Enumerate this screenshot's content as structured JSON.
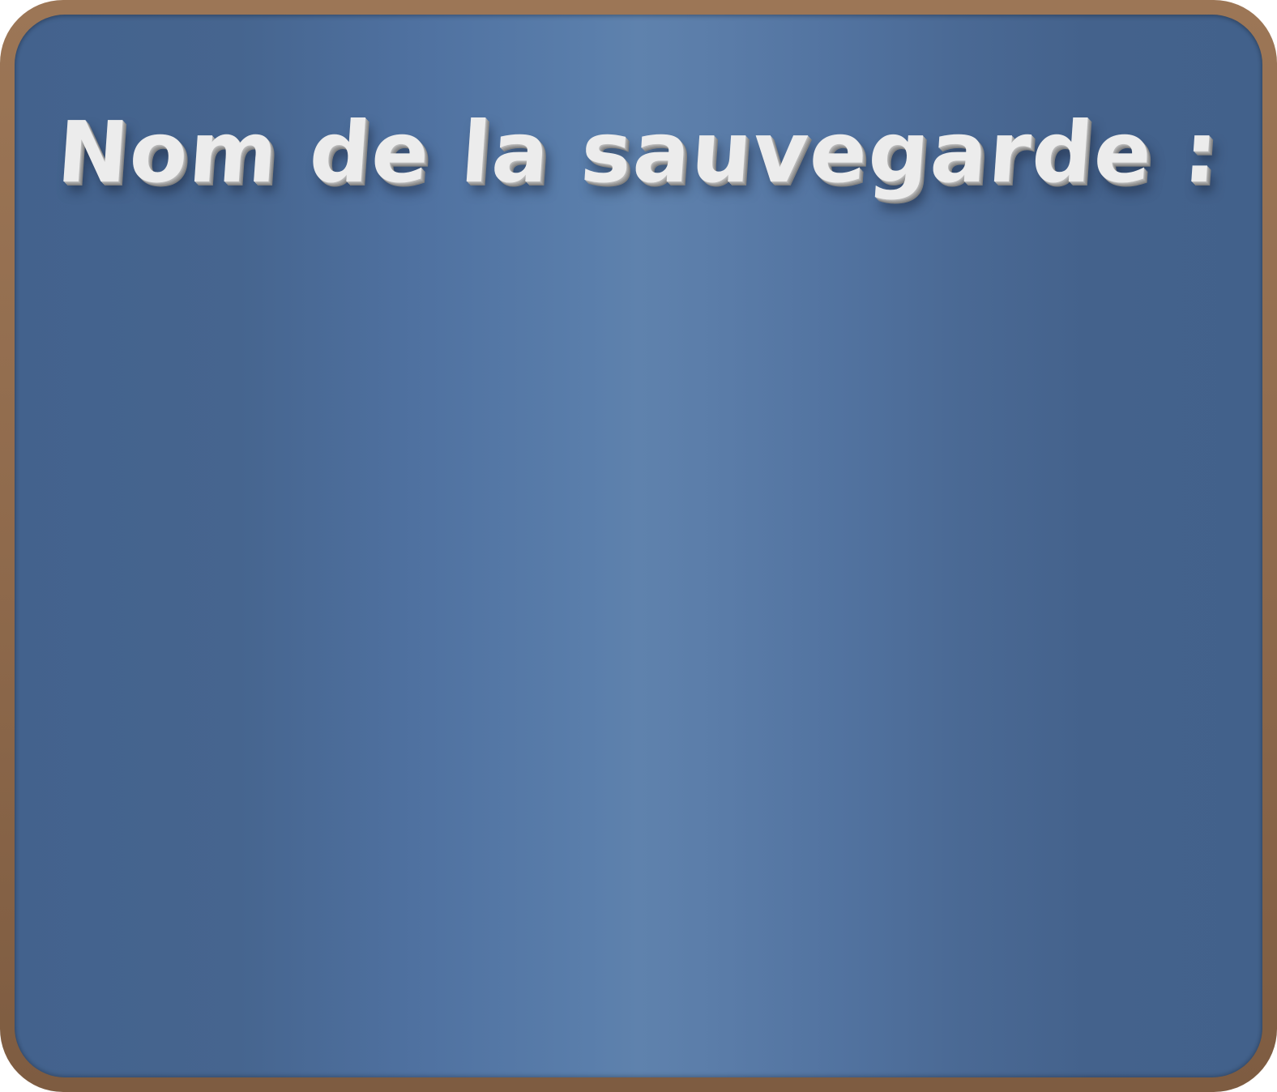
{
  "dialog": {
    "title": "Nom de la sauvegarde :"
  },
  "colors": {
    "frame": "#9c7656",
    "panel_edge": "#43628d",
    "panel_center": "#5f82ad",
    "title_text": "#ececec"
  }
}
